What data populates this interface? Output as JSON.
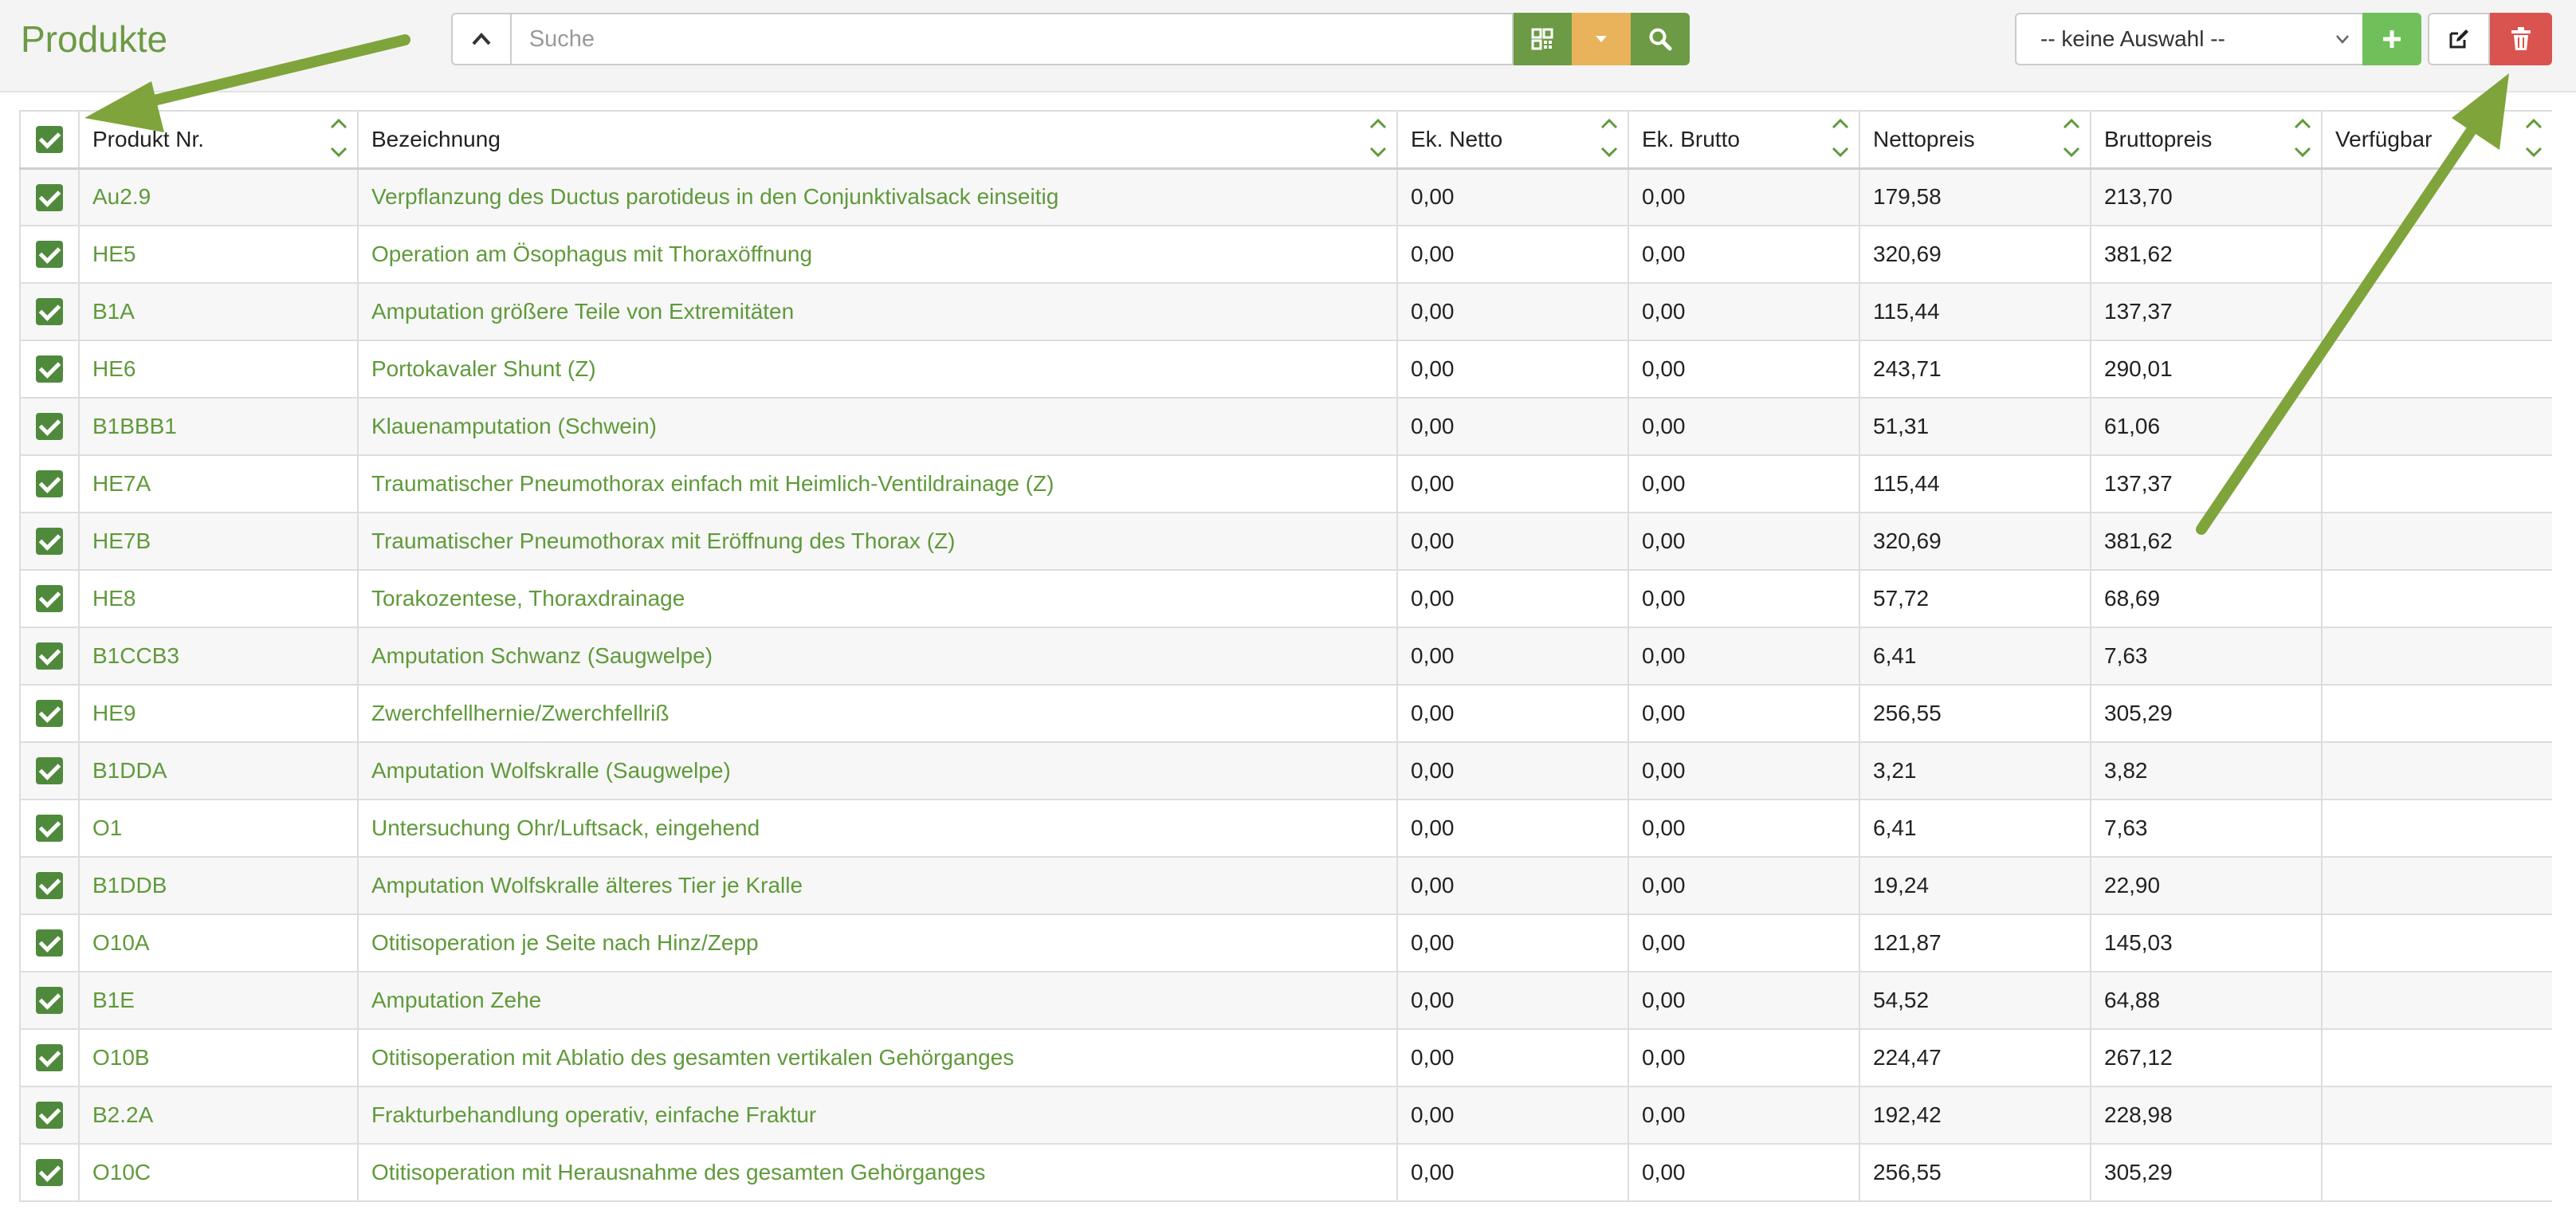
{
  "header": {
    "title": "Produkte",
    "search_placeholder": "Suche",
    "select_value": "-- keine Auswahl --",
    "icons": {
      "collapse": "chevron-up-icon",
      "qr": "qr-code-icon",
      "dropdown": "caret-down-icon",
      "search": "search-icon",
      "add": "plus-icon",
      "edit": "edit-icon",
      "delete": "trash-icon"
    }
  },
  "colors": {
    "brand_green": "#6c9a45",
    "link_green": "#5f9a3a",
    "add_green": "#6fbf5a",
    "warning_orange": "#e9b35b",
    "danger_red": "#d9534f",
    "checkbox_green": "#4f8a3c",
    "arrow_green": "#7fa43b"
  },
  "table": {
    "columns": [
      "Produkt Nr.",
      "Bezeichnung",
      "Ek. Netto",
      "Ek. Brutto",
      "Nettopreis",
      "Bruttopreis",
      "Verfügbar"
    ],
    "rows": [
      {
        "nr": "Au2.9",
        "name": "Verpflanzung des Ductus parotideus in den Conjunktivalsack einseitig",
        "ek_netto": "0,00",
        "ek_brutto": "0,00",
        "netto": "179,58",
        "brutto": "213,70",
        "verfuegbar": ""
      },
      {
        "nr": "HE5",
        "name": "Operation am Ösophagus mit Thoraxöffnung",
        "ek_netto": "0,00",
        "ek_brutto": "0,00",
        "netto": "320,69",
        "brutto": "381,62",
        "verfuegbar": ""
      },
      {
        "nr": "B1A",
        "name": "Amputation größere Teile von Extremitäten",
        "ek_netto": "0,00",
        "ek_brutto": "0,00",
        "netto": "115,44",
        "brutto": "137,37",
        "verfuegbar": ""
      },
      {
        "nr": "HE6",
        "name": "Portokavaler Shunt (Z)",
        "ek_netto": "0,00",
        "ek_brutto": "0,00",
        "netto": "243,71",
        "brutto": "290,01",
        "verfuegbar": ""
      },
      {
        "nr": "B1BBB1",
        "name": "Klauenamputation (Schwein)",
        "ek_netto": "0,00",
        "ek_brutto": "0,00",
        "netto": "51,31",
        "brutto": "61,06",
        "verfuegbar": ""
      },
      {
        "nr": "HE7A",
        "name": "Traumatischer Pneumothorax einfach mit Heimlich-Ventildrainage (Z)",
        "ek_netto": "0,00",
        "ek_brutto": "0,00",
        "netto": "115,44",
        "brutto": "137,37",
        "verfuegbar": ""
      },
      {
        "nr": "HE7B",
        "name": "Traumatischer Pneumothorax mit Eröffnung des Thorax (Z)",
        "ek_netto": "0,00",
        "ek_brutto": "0,00",
        "netto": "320,69",
        "brutto": "381,62",
        "verfuegbar": ""
      },
      {
        "nr": "HE8",
        "name": "Torakozentese, Thoraxdrainage",
        "ek_netto": "0,00",
        "ek_brutto": "0,00",
        "netto": "57,72",
        "brutto": "68,69",
        "verfuegbar": ""
      },
      {
        "nr": "B1CCB3",
        "name": "Amputation Schwanz (Saugwelpe)",
        "ek_netto": "0,00",
        "ek_brutto": "0,00",
        "netto": "6,41",
        "brutto": "7,63",
        "verfuegbar": ""
      },
      {
        "nr": "HE9",
        "name": "Zwerchfellhernie/Zwerchfellriß",
        "ek_netto": "0,00",
        "ek_brutto": "0,00",
        "netto": "256,55",
        "brutto": "305,29",
        "verfuegbar": ""
      },
      {
        "nr": "B1DDA",
        "name": "Amputation Wolfskralle (Saugwelpe)",
        "ek_netto": "0,00",
        "ek_brutto": "0,00",
        "netto": "3,21",
        "brutto": "3,82",
        "verfuegbar": ""
      },
      {
        "nr": "O1",
        "name": "Untersuchung Ohr/Luftsack, eingehend",
        "ek_netto": "0,00",
        "ek_brutto": "0,00",
        "netto": "6,41",
        "brutto": "7,63",
        "verfuegbar": ""
      },
      {
        "nr": "B1DDB",
        "name": "Amputation Wolfskralle älteres Tier je Kralle",
        "ek_netto": "0,00",
        "ek_brutto": "0,00",
        "netto": "19,24",
        "brutto": "22,90",
        "verfuegbar": ""
      },
      {
        "nr": "O10A",
        "name": "Otitisoperation je Seite nach Hinz/Zepp",
        "ek_netto": "0,00",
        "ek_brutto": "0,00",
        "netto": "121,87",
        "brutto": "145,03",
        "verfuegbar": ""
      },
      {
        "nr": "B1E",
        "name": "Amputation Zehe",
        "ek_netto": "0,00",
        "ek_brutto": "0,00",
        "netto": "54,52",
        "brutto": "64,88",
        "verfuegbar": ""
      },
      {
        "nr": "O10B",
        "name": "Otitisoperation mit Ablatio des gesamten vertikalen Gehörganges",
        "ek_netto": "0,00",
        "ek_brutto": "0,00",
        "netto": "224,47",
        "brutto": "267,12",
        "verfuegbar": ""
      },
      {
        "nr": "B2.2A",
        "name": "Frakturbehandlung operativ, einfache Fraktur",
        "ek_netto": "0,00",
        "ek_brutto": "0,00",
        "netto": "192,42",
        "brutto": "228,98",
        "verfuegbar": ""
      },
      {
        "nr": "O10C",
        "name": "Otitisoperation mit Herausnahme des gesamten Gehörganges",
        "ek_netto": "0,00",
        "ek_brutto": "0,00",
        "netto": "256,55",
        "brutto": "305,29",
        "verfuegbar": ""
      }
    ]
  }
}
